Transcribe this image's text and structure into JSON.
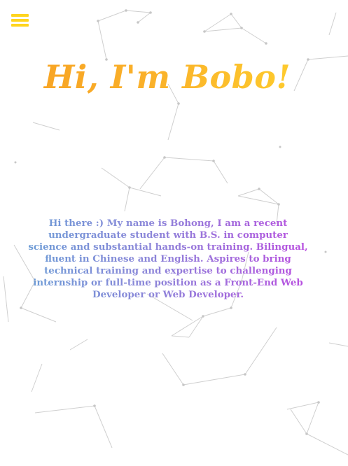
{
  "nav": {
    "menu_icon": "hamburger-menu-icon"
  },
  "hero": {
    "title": "Hi, I'm Bobo!"
  },
  "intro": {
    "text": "Hi there :) My name is Bohong, I am a recent undergraduate student with B.S. in computer science and substantial hands-on training. Bilingual, fluent in Chinese and English. Aspires to bring technical training and expertise to challenging internship or full-time position as a Front-End Web Developer or Web Developer."
  },
  "colors": {
    "menu_icon": "#ffd51f",
    "title_gradient_start": "#f7a022",
    "title_gradient_end": "#ffd22e",
    "intro_gradient_start": "#6d9cd6",
    "intro_gradient_end": "#b94fe0",
    "background": "#ffffff",
    "network_lines": "#cfcfcf"
  }
}
